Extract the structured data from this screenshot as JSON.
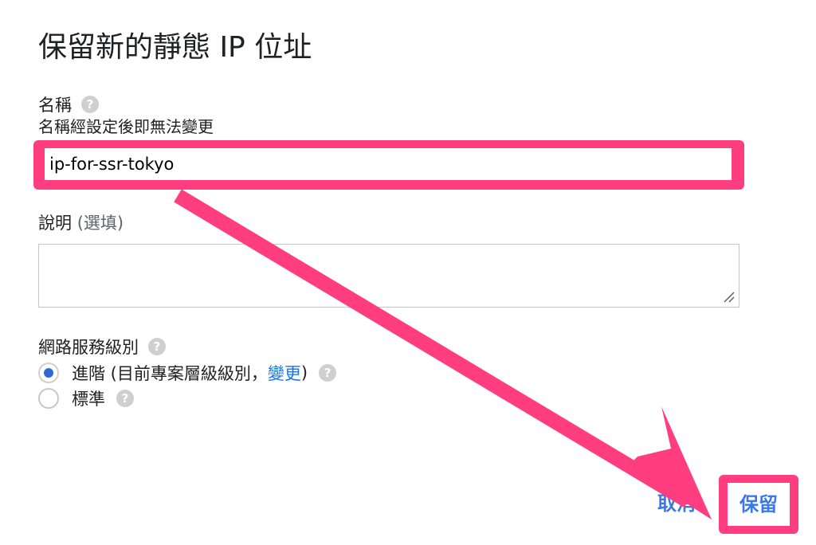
{
  "dialog": {
    "title": "保留新的靜態 IP 位址"
  },
  "name_field": {
    "label": "名稱",
    "hint": "名稱經設定後即無法變更",
    "value": "ip-for-ssr-tokyo"
  },
  "description_field": {
    "label": "說明",
    "optional": "(選填)",
    "value": ""
  },
  "network_tier": {
    "label": "網路服務級別",
    "options": [
      {
        "label_prefix": "進階 (目前專案層級級別，",
        "link": "變更",
        "label_suffix": ")",
        "selected": true
      },
      {
        "label": "標準",
        "selected": false
      }
    ]
  },
  "actions": {
    "cancel_label": "取消",
    "save_label": "保留"
  },
  "icons": {
    "help": "help-icon",
    "arrow": "annotation-arrow"
  },
  "colors": {
    "highlight": "#ff3d7f",
    "link": "#1a73e8",
    "button_text": "#3b78e7",
    "radio_selected": "#3367d6"
  }
}
